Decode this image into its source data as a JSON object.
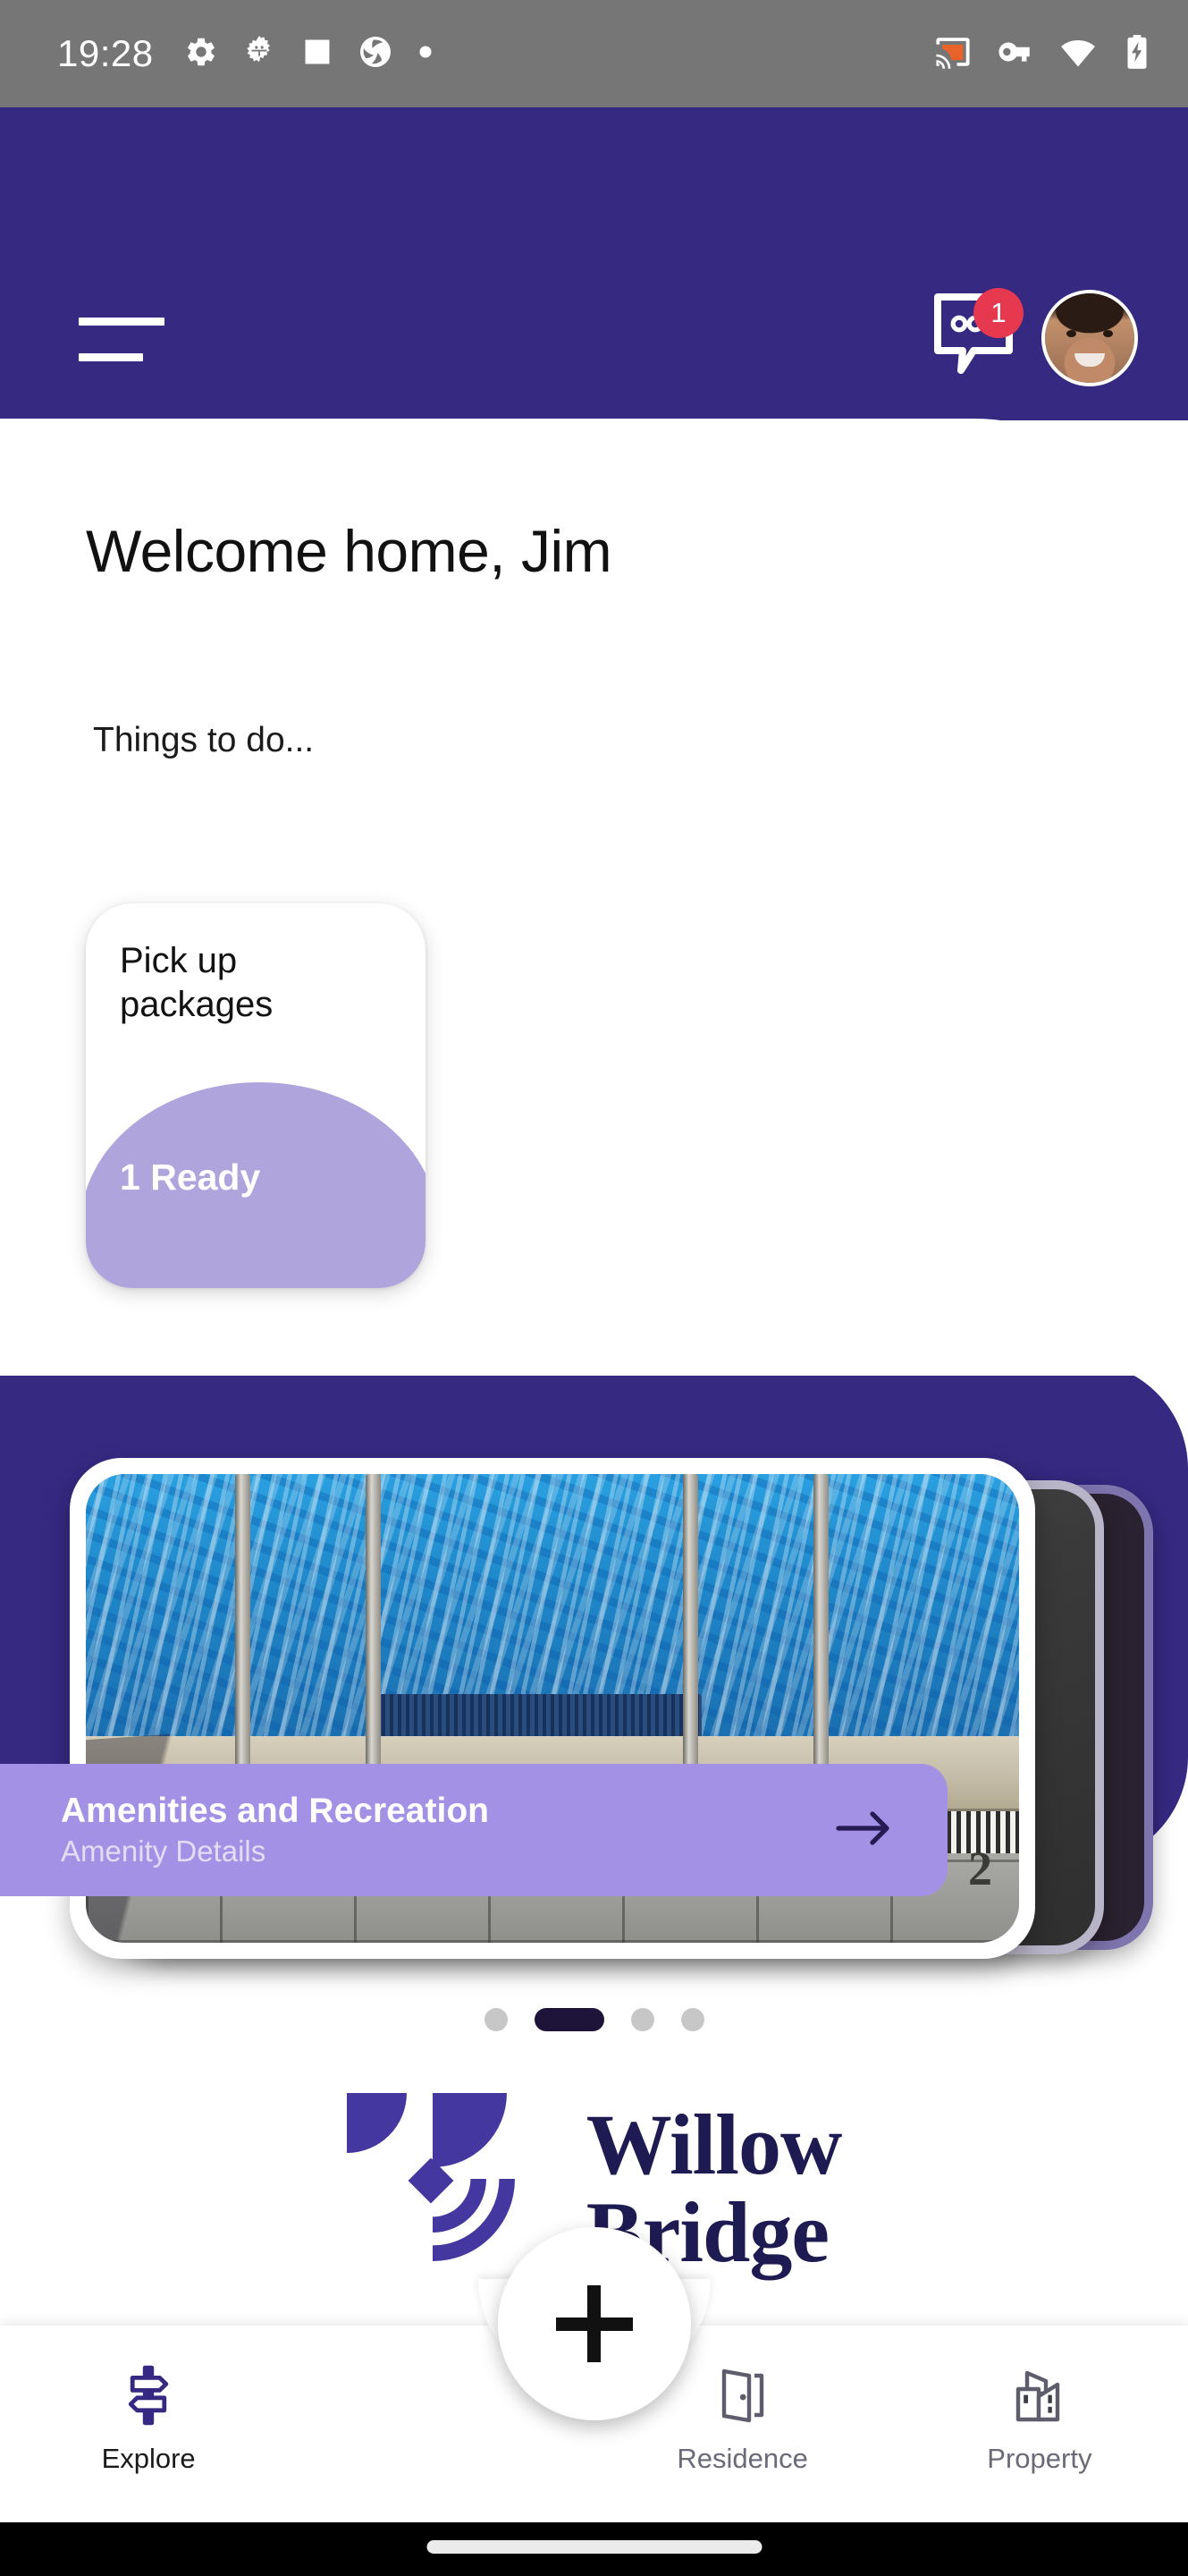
{
  "status_bar": {
    "time": "19:28",
    "left_icons": [
      "gear-icon",
      "bug-gear-icon",
      "square-icon",
      "aperture-icon",
      "dot-icon"
    ],
    "right_icons": [
      "cast-icon",
      "vpn-key-icon",
      "wifi-icon",
      "battery-charging-icon"
    ]
  },
  "header": {
    "menu_icon": "hamburger-icon",
    "chat_icon": "chat-bubble-icon",
    "chat_badge_count": "1",
    "avatar": "user-avatar"
  },
  "main": {
    "welcome_title": "Welcome home, Jim",
    "things_to_do_label": "Things to do...",
    "task_cards": [
      {
        "title": "Pick up packages",
        "status": "1 Ready"
      }
    ]
  },
  "carousel": {
    "cards": [
      {
        "title": "Amenities and Recreation",
        "subtitle": "Amenity Details",
        "image": "swimming-pool-photo",
        "lane_number": "2",
        "arrow_icon": "arrow-right-icon"
      }
    ],
    "dots": [
      {
        "active": false
      },
      {
        "active": true
      },
      {
        "active": false
      },
      {
        "active": false
      }
    ]
  },
  "branding": {
    "logo_mark": "willow-bridge-arcs-logo",
    "name_line1": "Willow",
    "name_line2": "Bridge"
  },
  "bottom_nav": {
    "items": [
      {
        "label": "Explore",
        "icon": "signpost-icon",
        "active": true
      },
      {
        "label": "Residence",
        "icon": "door-icon",
        "active": false
      },
      {
        "label": "Property",
        "icon": "buildings-icon",
        "active": false
      }
    ],
    "fab": {
      "icon": "plus-icon",
      "label": "Add"
    }
  },
  "system_nav": {
    "home_indicator": "home-indicator-pill"
  },
  "colors": {
    "brand_purple": "#352982",
    "lavender": "#A391E6",
    "light_lavender": "#AFA4DC",
    "badge_red": "#E63950",
    "status_bar_gray": "#767676",
    "logo_navy": "#1E1A52"
  }
}
